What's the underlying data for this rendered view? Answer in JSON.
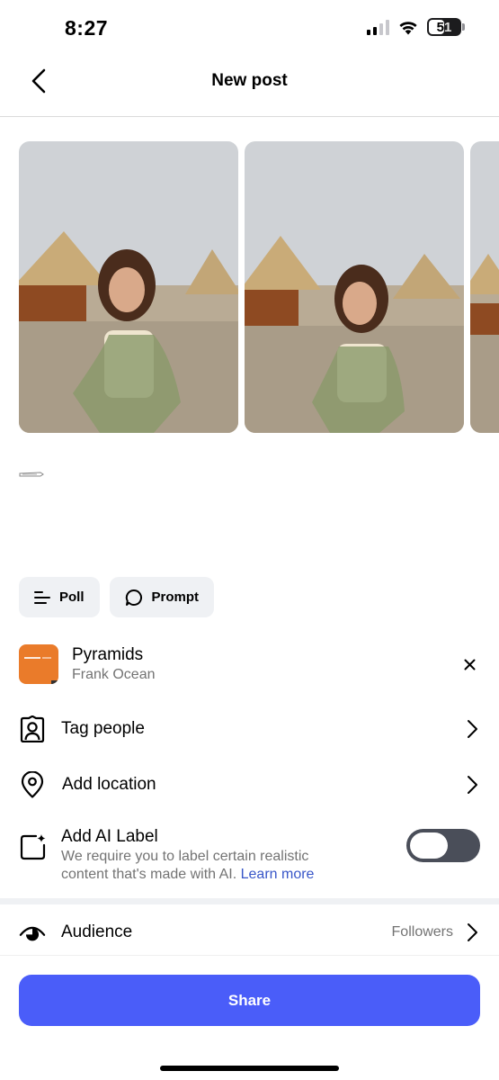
{
  "status_bar": {
    "time": "8:27",
    "battery": "51",
    "battery_fraction": 0.51
  },
  "header": {
    "title": "New post",
    "back_icon": "chevron-left-icon"
  },
  "carousel": {
    "photo_count_visible": 3,
    "photos": [
      {
        "description_icon": "photo"
      },
      {
        "description_icon": "photo"
      },
      {
        "description_icon": "photo"
      }
    ]
  },
  "chips": {
    "poll_label": "Poll",
    "poll_icon": "poll-icon",
    "prompt_label": "Prompt",
    "prompt_icon": "speech-bubble-icon"
  },
  "music": {
    "title": "Pyramids",
    "artist": "Frank Ocean",
    "remove_icon": "close-icon",
    "album_color": "#ea7b2a"
  },
  "rows": {
    "tag_people": {
      "label": "Tag people",
      "icon": "tag-person-icon"
    },
    "add_location": {
      "label": "Add location",
      "icon": "location-pin-icon"
    },
    "audience": {
      "label": "Audience",
      "value": "Followers",
      "icon": "eye-icon"
    }
  },
  "ai_label": {
    "title": "Add AI Label",
    "description": "We require you to label certain realistic content that's made with AI.",
    "learn_more": "Learn more",
    "toggle_on": false,
    "icon": "ai-sparkle-square-icon"
  },
  "share": {
    "label": "Share",
    "color": "#4a5df9"
  }
}
